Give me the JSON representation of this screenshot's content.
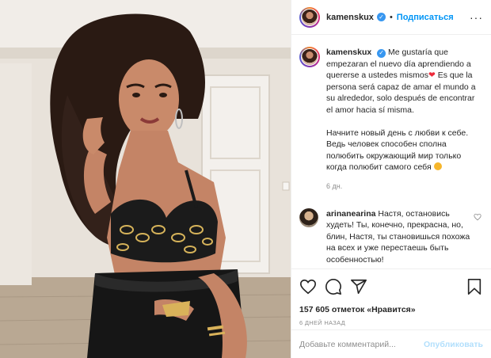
{
  "post": {
    "header": {
      "username": "kamenskux",
      "separator": "•",
      "follow_label": "Подписаться",
      "more_label": "···"
    },
    "caption": {
      "username": "kamenskux",
      "spanish_a": "Me gustaría que empezaran el nuevo día aprendiendo a quererse a ustedes mismos",
      "heart": "❤",
      "spanish_b": "Es que la persona será capaz de amar el mundo a su alrededor, solo después de encontrar el amor hacia sí misma.",
      "russian": "Начните новый день с любви к себе. Ведь человек способен сполна полюбить окружающий мир только когда полюбит самого себя",
      "time": "6 дн."
    },
    "comment": {
      "username": "arinanearina",
      "text": "Настя, остановись худеть! Ты, конечно, прекрасна, но, блин, Настя, ты становишься похожа на всех и уже перестаешь быть особенностью!"
    },
    "actions": {
      "likes": "157 605 отметок «Нравится»",
      "date": "6 ДНЕЙ НАЗАД"
    },
    "add_comment": {
      "placeholder": "Добавьте комментарий...",
      "publish_label": "Опубликовать"
    }
  },
  "icons": {
    "verified": "verified-badge-icon",
    "like": "heart-icon",
    "comment": "comment-icon",
    "share": "share-icon",
    "save": "bookmark-icon",
    "comment_like": "heart-icon"
  },
  "colors": {
    "accent": "#0095f6",
    "verified": "#3897f0",
    "muted": "#8e8e8e",
    "publish_disabled": "#b2dffc"
  }
}
